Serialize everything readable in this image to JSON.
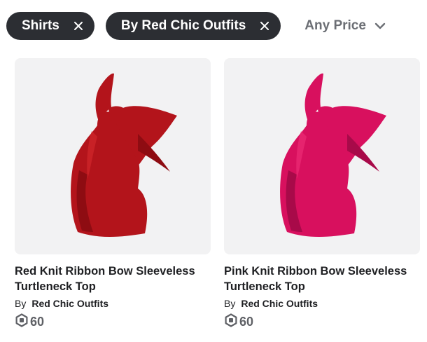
{
  "filters": {
    "chips": [
      {
        "label": "Shirts"
      },
      {
        "label": "By Red Chic Outfits"
      }
    ],
    "price_dropdown": {
      "label": "Any Price"
    }
  },
  "items": [
    {
      "title_line1": "Red Knit Ribbon Bow Sleeveless",
      "title_line2": "Turtleneck Top",
      "by_label": "By",
      "creator": "Red Chic Outfits",
      "price": "60",
      "color": "#b3141b",
      "shade": "#8e0c12",
      "highlight": "#d62a2f"
    },
    {
      "title_line1": "Pink Knit Ribbon Bow Sleeveless",
      "title_line2": "Turtleneck Top",
      "by_label": "By",
      "creator": "Red Chic Outfits",
      "price": "60",
      "color": "#d8105e",
      "shade": "#a80a49",
      "highlight": "#f0307a"
    }
  ],
  "colors": {
    "chip_bg": "#2c2e33",
    "chip_text": "#ffffff",
    "muted_text": "#6b6e74",
    "thumb_bg": "#f2f2f3"
  },
  "icons": [
    "close-icon",
    "chevron-down-icon",
    "robux-icon"
  ]
}
